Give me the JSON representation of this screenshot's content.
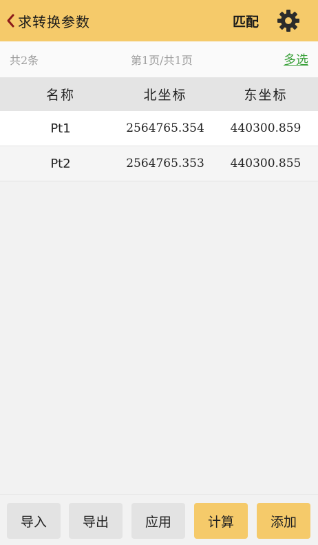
{
  "header": {
    "title": "求转换参数",
    "match_label": "匹配",
    "back_icon": "chevron-left-icon",
    "settings_icon": "gear-icon"
  },
  "info": {
    "count": "共2条",
    "page": "第1页/共1页",
    "multi_select": "多选"
  },
  "table": {
    "columns": [
      "名称",
      "北坐标",
      "东坐标"
    ],
    "rows": [
      {
        "name": "Pt1",
        "north": "2564765.354",
        "east": "440300.859"
      },
      {
        "name": "Pt2",
        "north": "2564765.353",
        "east": "440300.855"
      }
    ]
  },
  "footer": {
    "import": "导入",
    "export": "导出",
    "apply": "应用",
    "compute": "计算",
    "add": "添加"
  },
  "colors": {
    "accent": "#f5ca6a",
    "link": "#3aa13a",
    "header_row": "#e4e4e4"
  }
}
